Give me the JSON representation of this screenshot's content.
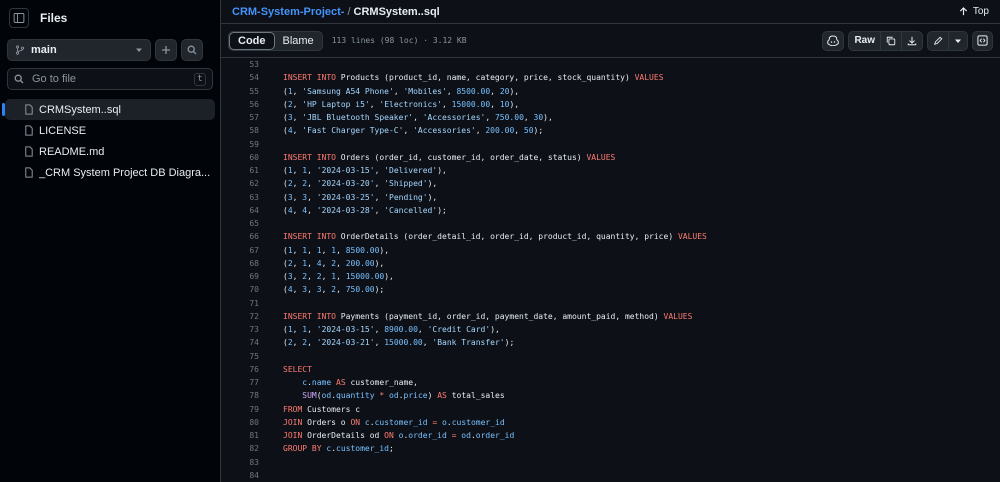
{
  "sidebar": {
    "title": "Files",
    "branch": "main",
    "search_placeholder": "Go to file",
    "search_shortcut": "t",
    "files": [
      {
        "name": "CRMSystem..sql",
        "active": true
      },
      {
        "name": "LICENSE",
        "active": false
      },
      {
        "name": "README.md",
        "active": false
      },
      {
        "name": "_CRM System Project DB Diagra...",
        "active": false
      }
    ]
  },
  "header": {
    "repo_link": "CRM-System-Project-",
    "separator": "/",
    "file_name": "CRMSystem..sql",
    "top_label": "Top"
  },
  "toolbar": {
    "code_tab": "Code",
    "blame_tab": "Blame",
    "file_info": "113 lines (98 loc) · 3.12 KB",
    "raw_label": "Raw"
  },
  "code_lines": [
    {
      "n": "53",
      "tokens": []
    },
    {
      "n": "54",
      "tokens": [
        [
          "kw",
          "INSERT INTO"
        ],
        [
          "t",
          " Products (product_id, name, category, price, stock_quantity) "
        ],
        [
          "kw",
          "VALUES"
        ]
      ]
    },
    {
      "n": "55",
      "tokens": [
        [
          "t",
          "("
        ],
        [
          "num",
          "1"
        ],
        [
          "t",
          ", "
        ],
        [
          "str",
          "'Samsung A54 Phone'"
        ],
        [
          "t",
          ", "
        ],
        [
          "str",
          "'Mobiles'"
        ],
        [
          "t",
          ", "
        ],
        [
          "num",
          "8500.00"
        ],
        [
          "t",
          ", "
        ],
        [
          "num",
          "20"
        ],
        [
          "t",
          "),"
        ]
      ]
    },
    {
      "n": "56",
      "tokens": [
        [
          "t",
          "("
        ],
        [
          "num",
          "2"
        ],
        [
          "t",
          ", "
        ],
        [
          "str",
          "'HP Laptop i5'"
        ],
        [
          "t",
          ", "
        ],
        [
          "str",
          "'Electronics'"
        ],
        [
          "t",
          ", "
        ],
        [
          "num",
          "15000.00"
        ],
        [
          "t",
          ", "
        ],
        [
          "num",
          "10"
        ],
        [
          "t",
          "),"
        ]
      ]
    },
    {
      "n": "57",
      "tokens": [
        [
          "t",
          "("
        ],
        [
          "num",
          "3"
        ],
        [
          "t",
          ", "
        ],
        [
          "str",
          "'JBL Bluetooth Speaker'"
        ],
        [
          "t",
          ", "
        ],
        [
          "str",
          "'Accessories'"
        ],
        [
          "t",
          ", "
        ],
        [
          "num",
          "750.00"
        ],
        [
          "t",
          ", "
        ],
        [
          "num",
          "30"
        ],
        [
          "t",
          "),"
        ]
      ]
    },
    {
      "n": "58",
      "tokens": [
        [
          "t",
          "("
        ],
        [
          "num",
          "4"
        ],
        [
          "t",
          ", "
        ],
        [
          "str",
          "'Fast Charger Type-C'"
        ],
        [
          "t",
          ", "
        ],
        [
          "str",
          "'Accessories'"
        ],
        [
          "t",
          ", "
        ],
        [
          "num",
          "200.00"
        ],
        [
          "t",
          ", "
        ],
        [
          "num",
          "50"
        ],
        [
          "t",
          ");"
        ]
      ]
    },
    {
      "n": "59",
      "tokens": []
    },
    {
      "n": "60",
      "tokens": [
        [
          "kw",
          "INSERT INTO"
        ],
        [
          "t",
          " Orders (order_id, customer_id, order_date, status) "
        ],
        [
          "kw",
          "VALUES"
        ]
      ]
    },
    {
      "n": "61",
      "tokens": [
        [
          "t",
          "("
        ],
        [
          "num",
          "1"
        ],
        [
          "t",
          ", "
        ],
        [
          "num",
          "1"
        ],
        [
          "t",
          ", "
        ],
        [
          "str",
          "'2024-03-15'"
        ],
        [
          "t",
          ", "
        ],
        [
          "str",
          "'Delivered'"
        ],
        [
          "t",
          "),"
        ]
      ]
    },
    {
      "n": "62",
      "tokens": [
        [
          "t",
          "("
        ],
        [
          "num",
          "2"
        ],
        [
          "t",
          ", "
        ],
        [
          "num",
          "2"
        ],
        [
          "t",
          ", "
        ],
        [
          "str",
          "'2024-03-20'"
        ],
        [
          "t",
          ", "
        ],
        [
          "str",
          "'Shipped'"
        ],
        [
          "t",
          "),"
        ]
      ]
    },
    {
      "n": "63",
      "tokens": [
        [
          "t",
          "("
        ],
        [
          "num",
          "3"
        ],
        [
          "t",
          ", "
        ],
        [
          "num",
          "3"
        ],
        [
          "t",
          ", "
        ],
        [
          "str",
          "'2024-03-25'"
        ],
        [
          "t",
          ", "
        ],
        [
          "str",
          "'Pending'"
        ],
        [
          "t",
          "),"
        ]
      ]
    },
    {
      "n": "64",
      "tokens": [
        [
          "t",
          "("
        ],
        [
          "num",
          "4"
        ],
        [
          "t",
          ", "
        ],
        [
          "num",
          "4"
        ],
        [
          "t",
          ", "
        ],
        [
          "str",
          "'2024-03-28'"
        ],
        [
          "t",
          ", "
        ],
        [
          "str",
          "'Cancelled'"
        ],
        [
          "t",
          ");"
        ]
      ]
    },
    {
      "n": "65",
      "tokens": []
    },
    {
      "n": "66",
      "tokens": [
        [
          "kw",
          "INSERT INTO"
        ],
        [
          "t",
          " OrderDetails (order_detail_id, order_id, product_id, quantity, price) "
        ],
        [
          "kw",
          "VALUES"
        ]
      ]
    },
    {
      "n": "67",
      "tokens": [
        [
          "t",
          "("
        ],
        [
          "num",
          "1"
        ],
        [
          "t",
          ", "
        ],
        [
          "num",
          "1"
        ],
        [
          "t",
          ", "
        ],
        [
          "num",
          "1"
        ],
        [
          "t",
          ", "
        ],
        [
          "num",
          "1"
        ],
        [
          "t",
          ", "
        ],
        [
          "num",
          "8500.00"
        ],
        [
          "t",
          "),"
        ]
      ]
    },
    {
      "n": "68",
      "tokens": [
        [
          "t",
          "("
        ],
        [
          "num",
          "2"
        ],
        [
          "t",
          ", "
        ],
        [
          "num",
          "1"
        ],
        [
          "t",
          ", "
        ],
        [
          "num",
          "4"
        ],
        [
          "t",
          ", "
        ],
        [
          "num",
          "2"
        ],
        [
          "t",
          ", "
        ],
        [
          "num",
          "200.00"
        ],
        [
          "t",
          "),"
        ]
      ]
    },
    {
      "n": "69",
      "tokens": [
        [
          "t",
          "("
        ],
        [
          "num",
          "3"
        ],
        [
          "t",
          ", "
        ],
        [
          "num",
          "2"
        ],
        [
          "t",
          ", "
        ],
        [
          "num",
          "2"
        ],
        [
          "t",
          ", "
        ],
        [
          "num",
          "1"
        ],
        [
          "t",
          ", "
        ],
        [
          "num",
          "15000.00"
        ],
        [
          "t",
          "),"
        ]
      ]
    },
    {
      "n": "70",
      "tokens": [
        [
          "t",
          "("
        ],
        [
          "num",
          "4"
        ],
        [
          "t",
          ", "
        ],
        [
          "num",
          "3"
        ],
        [
          "t",
          ", "
        ],
        [
          "num",
          "3"
        ],
        [
          "t",
          ", "
        ],
        [
          "num",
          "2"
        ],
        [
          "t",
          ", "
        ],
        [
          "num",
          "750.00"
        ],
        [
          "t",
          ");"
        ]
      ]
    },
    {
      "n": "71",
      "tokens": []
    },
    {
      "n": "72",
      "tokens": [
        [
          "kw",
          "INSERT INTO"
        ],
        [
          "t",
          " Payments (payment_id, order_id, payment_date, amount_paid, method) "
        ],
        [
          "kw",
          "VALUES"
        ]
      ]
    },
    {
      "n": "73",
      "tokens": [
        [
          "t",
          "("
        ],
        [
          "num",
          "1"
        ],
        [
          "t",
          ", "
        ],
        [
          "num",
          "1"
        ],
        [
          "t",
          ", "
        ],
        [
          "str",
          "'2024-03-15'"
        ],
        [
          "t",
          ", "
        ],
        [
          "num",
          "8900.00"
        ],
        [
          "t",
          ", "
        ],
        [
          "str",
          "'Credit Card'"
        ],
        [
          "t",
          "),"
        ]
      ]
    },
    {
      "n": "74",
      "tokens": [
        [
          "t",
          "("
        ],
        [
          "num",
          "2"
        ],
        [
          "t",
          ", "
        ],
        [
          "num",
          "2"
        ],
        [
          "t",
          ", "
        ],
        [
          "str",
          "'2024-03-21'"
        ],
        [
          "t",
          ", "
        ],
        [
          "num",
          "15000.00"
        ],
        [
          "t",
          ", "
        ],
        [
          "str",
          "'Bank Transfer'"
        ],
        [
          "t",
          ");"
        ]
      ]
    },
    {
      "n": "75",
      "tokens": []
    },
    {
      "n": "76",
      "tokens": [
        [
          "kw",
          "SELECT"
        ]
      ]
    },
    {
      "n": "77",
      "tokens": [
        [
          "t",
          "    "
        ],
        [
          "num",
          "c"
        ],
        [
          "t",
          "."
        ],
        [
          "num",
          "name"
        ],
        [
          "t",
          " "
        ],
        [
          "kw",
          "AS"
        ],
        [
          "t",
          " customer_name,"
        ]
      ]
    },
    {
      "n": "78",
      "tokens": [
        [
          "t",
          "    "
        ],
        [
          "fn",
          "SUM"
        ],
        [
          "t",
          "("
        ],
        [
          "num",
          "od"
        ],
        [
          "t",
          "."
        ],
        [
          "num",
          "quantity"
        ],
        [
          "t",
          " "
        ],
        [
          "kw",
          "*"
        ],
        [
          "t",
          " "
        ],
        [
          "num",
          "od"
        ],
        [
          "t",
          "."
        ],
        [
          "num",
          "price"
        ],
        [
          "t",
          ") "
        ],
        [
          "kw",
          "AS"
        ],
        [
          "t",
          " total_sales"
        ]
      ]
    },
    {
      "n": "79",
      "tokens": [
        [
          "kw",
          "FROM"
        ],
        [
          "t",
          " Customers c"
        ]
      ]
    },
    {
      "n": "80",
      "tokens": [
        [
          "kw",
          "JOIN"
        ],
        [
          "t",
          " Orders o "
        ],
        [
          "kw",
          "ON"
        ],
        [
          "t",
          " "
        ],
        [
          "num",
          "c"
        ],
        [
          "t",
          "."
        ],
        [
          "num",
          "customer_id"
        ],
        [
          "t",
          " "
        ],
        [
          "kw",
          "="
        ],
        [
          "t",
          " "
        ],
        [
          "num",
          "o"
        ],
        [
          "t",
          "."
        ],
        [
          "num",
          "customer_id"
        ]
      ]
    },
    {
      "n": "81",
      "tokens": [
        [
          "kw",
          "JOIN"
        ],
        [
          "t",
          " OrderDetails od "
        ],
        [
          "kw",
          "ON"
        ],
        [
          "t",
          " "
        ],
        [
          "num",
          "o"
        ],
        [
          "t",
          "."
        ],
        [
          "num",
          "order_id"
        ],
        [
          "t",
          " "
        ],
        [
          "kw",
          "="
        ],
        [
          "t",
          " "
        ],
        [
          "num",
          "od"
        ],
        [
          "t",
          "."
        ],
        [
          "num",
          "order_id"
        ]
      ]
    },
    {
      "n": "82",
      "tokens": [
        [
          "kw",
          "GROUP BY"
        ],
        [
          "t",
          " "
        ],
        [
          "num",
          "c"
        ],
        [
          "t",
          "."
        ],
        [
          "num",
          "customer_id"
        ],
        [
          "t",
          ";"
        ]
      ]
    },
    {
      "n": "83",
      "tokens": []
    },
    {
      "n": "84",
      "tokens": []
    }
  ]
}
